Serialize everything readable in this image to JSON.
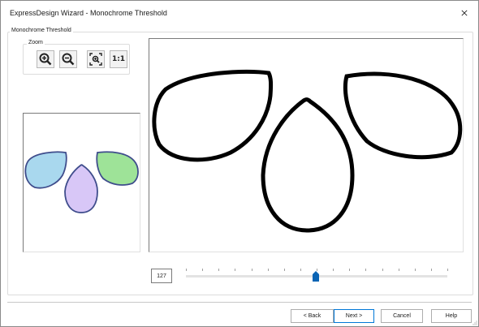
{
  "window": {
    "title": "ExpressDesign Wizard - Monochrome Threshold"
  },
  "group": {
    "label": "Monochrome Threshold"
  },
  "zoom": {
    "label": "Zoom",
    "buttons": [
      {
        "icon": "zoom-in-icon"
      },
      {
        "icon": "zoom-out-icon"
      },
      {
        "icon": "zoom-fit-icon"
      },
      {
        "label": "1:1"
      }
    ]
  },
  "preview": {
    "shape_colors": {
      "left": "#a9d8ee",
      "middle": "#d8c7f7",
      "right": "#9ee398",
      "outline": "#3f4d8c"
    }
  },
  "threshold": {
    "value": "127",
    "range": [
      0,
      255
    ],
    "accent": "#0a64b4"
  },
  "footer": {
    "back_label": "< Back",
    "next_label": "Next >",
    "cancel_label": "Cancel",
    "help_label": "Help"
  }
}
